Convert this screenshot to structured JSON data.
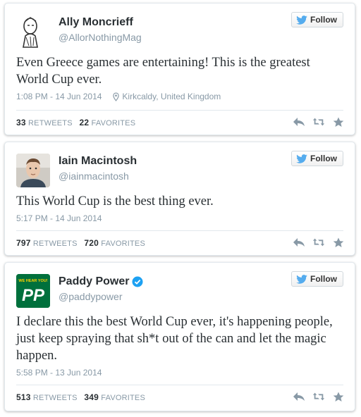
{
  "follow_label": "Follow",
  "retweets_label": "RETWEETS",
  "favorites_label": "FAVORITES",
  "tweets": [
    {
      "name": "Ally Moncrieff",
      "handle": "@AllorNothingMag",
      "text": "Even Greece games are entertaining! This is the greatest World Cup ever.",
      "timestamp": "1:08 PM - 14 Jun 2014",
      "location": "Kirkcaldy, United Kingdom",
      "retweets": "33",
      "favorites": "22"
    },
    {
      "name": "Iain Macintosh",
      "handle": "@iainmacintosh",
      "text": "This World Cup is the best thing ever.",
      "timestamp": "5:17 PM - 14 Jun 2014",
      "retweets": "797",
      "favorites": "720"
    },
    {
      "name": "Paddy Power",
      "handle": "@paddypower",
      "text": "I declare this the best World Cup ever, it's happening people, just keep spraying that sh*t out of the can and let the magic happen.",
      "timestamp": "5:58 PM - 13 Jun 2014",
      "retweets": "513",
      "favorites": "349",
      "logo": {
        "tag": "WE HEAR YOU!",
        "mark": "PP"
      }
    }
  ],
  "colors": {
    "twitter_blue": "#55acee",
    "verified": "#1da1f2",
    "paddy_green": "#00703c"
  }
}
